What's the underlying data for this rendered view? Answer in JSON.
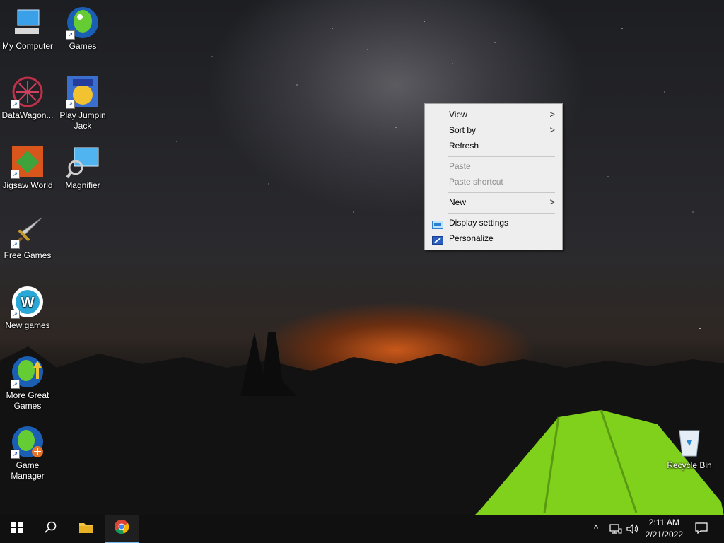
{
  "desktop": {
    "icons": [
      {
        "label": "My Computer"
      },
      {
        "label": "Games"
      },
      {
        "label": "DataWagon..."
      },
      {
        "label": "Play Jumpin Jack"
      },
      {
        "label": "Jigsaw World"
      },
      {
        "label": "Magnifier"
      },
      {
        "label": "Free Games"
      },
      {
        "label": "New games"
      },
      {
        "label": "More Great Games"
      },
      {
        "label": "Game Manager"
      },
      {
        "label": "Recycle Bin"
      }
    ]
  },
  "context_menu": {
    "items": [
      {
        "label": "View",
        "enabled": true,
        "submenu": true
      },
      {
        "label": "Sort by",
        "enabled": true,
        "submenu": true
      },
      {
        "label": "Refresh",
        "enabled": true,
        "submenu": false
      },
      {
        "label": "Paste",
        "enabled": false,
        "submenu": false
      },
      {
        "label": "Paste shortcut",
        "enabled": false,
        "submenu": false
      },
      {
        "label": "New",
        "enabled": true,
        "submenu": true
      },
      {
        "label": "Display settings",
        "enabled": true,
        "icon": "display-settings-icon"
      },
      {
        "label": "Personalize",
        "enabled": true,
        "icon": "personalize-icon"
      }
    ],
    "chevron": ">"
  },
  "taskbar": {
    "start_icon": "windows-start-icon",
    "search_icon": "search-icon",
    "pinned": [
      "file-explorer-icon",
      "chrome-icon"
    ],
    "tray": {
      "chevron": "^",
      "time": "2:11 AM",
      "date": "2/21/2022"
    }
  },
  "colors": {
    "taskbar_bg": "#101010",
    "menu_bg": "#eeeeee",
    "active_indicator": "#76b9ed"
  }
}
